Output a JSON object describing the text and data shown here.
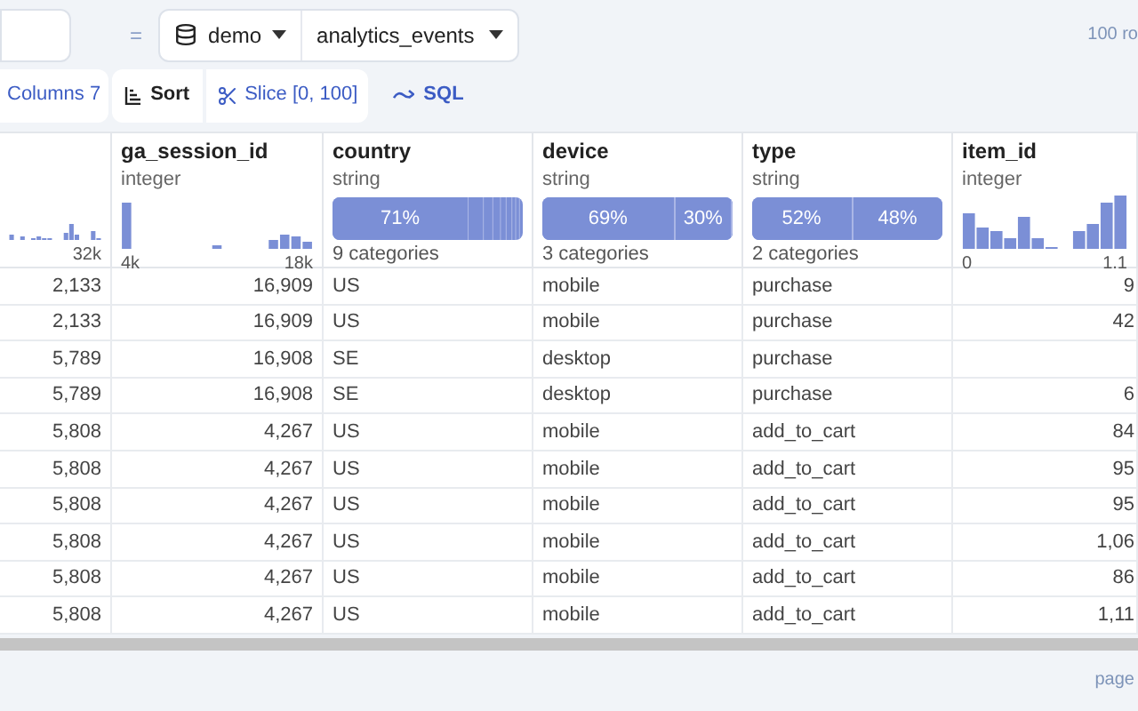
{
  "toolbar": {
    "equals": "=",
    "source": "demo",
    "table": "analytics_events",
    "row_count": "100 ro"
  },
  "actions": {
    "columns": "Columns 7",
    "sort": "Sort",
    "slice": "Slice [0, 100]",
    "sql": "SQL"
  },
  "columns": [
    {
      "kind": "histogram",
      "max": "32k"
    },
    {
      "name": "ga_session_id",
      "type": "integer",
      "kind": "histogram",
      "min": "4k",
      "max": "18k"
    },
    {
      "name": "country",
      "type": "string",
      "kind": "categories",
      "summary": "9 categories",
      "segments": [
        {
          "level": 0.71,
          "label": "71%"
        }
      ]
    },
    {
      "name": "device",
      "type": "string",
      "kind": "categories",
      "summary": "3 categories",
      "segments": [
        {
          "level": 0.69,
          "label": "69%"
        },
        {
          "level": 0.3,
          "label": "30%"
        },
        {
          "level": 0.01
        }
      ]
    },
    {
      "name": "type",
      "type": "string",
      "kind": "categories",
      "summary": "2 categories",
      "segments": [
        {
          "level": 0.52,
          "label": "52%"
        },
        {
          "level": 0.48,
          "label": "48%"
        }
      ]
    },
    {
      "name": "item_id",
      "type": "integer",
      "kind": "histogram",
      "min": "0",
      "max": "1.1"
    }
  ],
  "rows": [
    [
      "2,133",
      "16,909",
      "US",
      "mobile",
      "purchase",
      "9"
    ],
    [
      "2,133",
      "16,909",
      "US",
      "mobile",
      "purchase",
      "42"
    ],
    [
      "5,789",
      "16,908",
      "SE",
      "desktop",
      "purchase",
      ""
    ],
    [
      "5,789",
      "16,908",
      "SE",
      "desktop",
      "purchase",
      "6"
    ],
    [
      "5,808",
      "4,267",
      "US",
      "mobile",
      "add_to_cart",
      "84"
    ],
    [
      "5,808",
      "4,267",
      "US",
      "mobile",
      "add_to_cart",
      "95"
    ],
    [
      "5,808",
      "4,267",
      "US",
      "mobile",
      "add_to_cart",
      "95"
    ],
    [
      "5,808",
      "4,267",
      "US",
      "mobile",
      "add_to_cart",
      "1,06"
    ],
    [
      "5,808",
      "4,267",
      "US",
      "mobile",
      "add_to_cart",
      "86"
    ],
    [
      "5,808",
      "4,267",
      "US",
      "mobile",
      "add_to_cart",
      "1,11"
    ]
  ],
  "footer": {
    "page": "page"
  }
}
